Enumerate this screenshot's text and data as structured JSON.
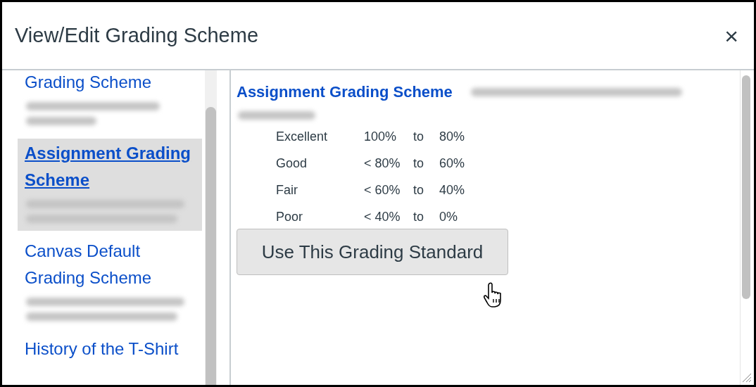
{
  "dialog": {
    "title": "View/Edit Grading Scheme",
    "close": "×"
  },
  "schemes": [
    {
      "name": "Grading Scheme",
      "selected": false
    },
    {
      "name": "Assignment Grading Scheme",
      "selected": true
    },
    {
      "name": "Canvas Default Grading Scheme",
      "selected": false
    },
    {
      "name": "History of the T-Shirt",
      "selected": false
    }
  ],
  "detail": {
    "title": "Assignment Grading Scheme",
    "rows": [
      {
        "grade": "Excellent",
        "from": "100%",
        "to_word": "to",
        "to": "80%"
      },
      {
        "grade": "Good",
        "from": "< 80%",
        "to_word": "to",
        "to": "60%"
      },
      {
        "grade": "Fair",
        "from": "< 60%",
        "to_word": "to",
        "to": "40%"
      },
      {
        "grade": "Poor",
        "from": "< 40%",
        "to_word": "to",
        "to": "0%"
      }
    ],
    "button": "Use This Grading Standard"
  }
}
